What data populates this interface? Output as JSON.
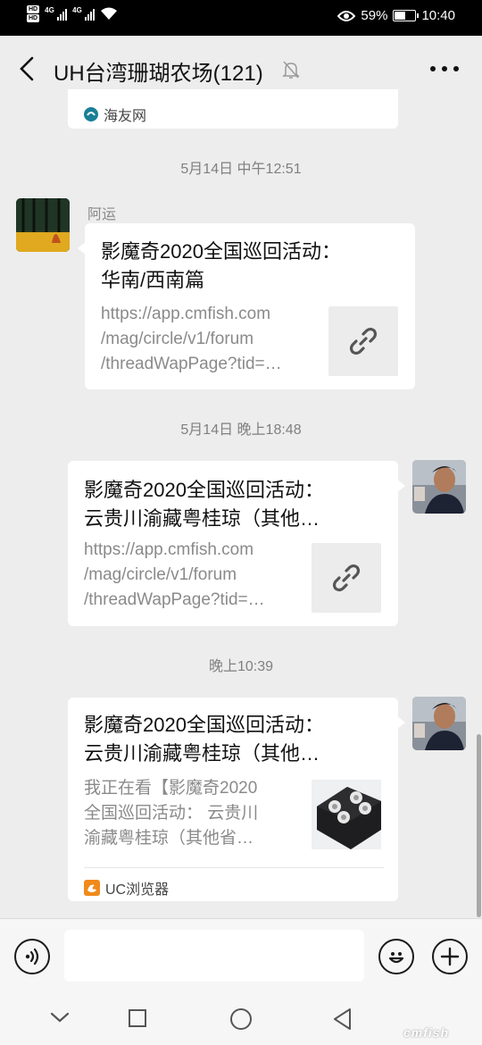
{
  "status_bar": {
    "hd1": "HD",
    "hd2": "HD",
    "net1": "4G",
    "net2": "4G",
    "battery_percent": "59%",
    "battery_level": 0.59,
    "time": "10:40"
  },
  "header": {
    "title": "UH台湾珊瑚农场(121)",
    "icons": [
      "back-icon",
      "mute-bell-icon",
      "more-icon"
    ]
  },
  "messages": [
    {
      "type": "source_fragment",
      "source": "海友网"
    },
    {
      "type": "timestamp",
      "text": "5月14日 中午12:51"
    },
    {
      "type": "link_card",
      "side": "left",
      "sender": "阿运",
      "title_line1": "影魔奇2020全国巡回活动：",
      "title_line2": "华南/西南篇",
      "desc_line1": "https://app.cmfish.com",
      "desc_line2": "/mag/circle/v1/forum",
      "desc_line3": "/threadWapPage?tid=…",
      "thumb_icon": "link-icon"
    },
    {
      "type": "timestamp",
      "text": "5月14日 晚上18:48"
    },
    {
      "type": "link_card",
      "side": "right",
      "title_line1": "影魔奇2020全国巡回活动：",
      "title_line2": "云贵川渝藏粤桂琼（其他…",
      "desc_line1": "https://app.cmfish.com",
      "desc_line2": "/mag/circle/v1/forum",
      "desc_line3": "/threadWapPage?tid=…",
      "thumb_icon": "link-icon"
    },
    {
      "type": "timestamp",
      "text": "晚上10:39"
    },
    {
      "type": "link_card",
      "side": "right",
      "title_line1": "影魔奇2020全国巡回活动：",
      "title_line2": "云贵川渝藏粤桂琼（其他…",
      "desc_line1": "我正在看【影魔奇2020",
      "desc_line2": "全国巡回活动： 云贵川",
      "desc_line3": "渝藏粤桂琼（其他省…",
      "thumb_icon": "led-light-image",
      "source": "UC浏览器"
    }
  ],
  "input_bar": {
    "icons": [
      "voice-icon",
      "emoji-icon",
      "plus-icon"
    ],
    "text_value": ""
  },
  "nav_bar": {
    "icons": [
      "collapse-icon",
      "recent-apps-icon",
      "home-icon",
      "back-triangle-icon"
    ]
  },
  "watermark": "cmfish"
}
